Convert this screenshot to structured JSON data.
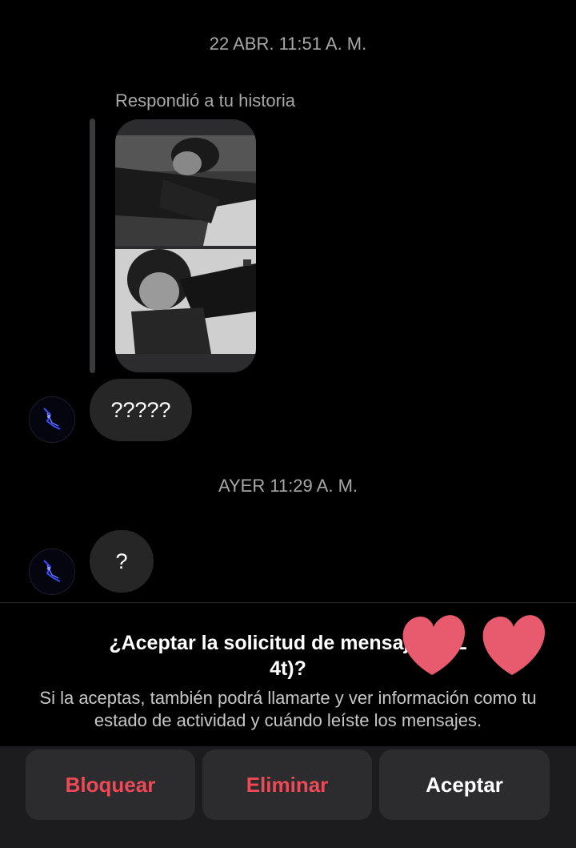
{
  "conversation": {
    "timestamp_1": "22 ABR. 11:51 A. M.",
    "reply_label": "Respondió a tu historia",
    "message_1": "?????",
    "timestamp_2": "AYER 11:29 A. M.",
    "message_2": "?"
  },
  "request": {
    "title_line_1": "¿Aceptar la solicitud de mensaje de L",
    "title_line_2": "4t)?",
    "description": "Si la aceptas, también podrá llamarte y ver información como tu estado de actividad y cuándo leíste los mensajes."
  },
  "actions": {
    "block_label": "Bloquear",
    "delete_label": "Eliminar",
    "accept_label": "Aceptar"
  },
  "colors": {
    "background": "#000000",
    "bubble": "#262626",
    "destructive": "#ed4956",
    "secondary_text": "#a8a8a8",
    "redaction_heart": "#e85a6e"
  },
  "icons": {
    "avatar": "avatar-image",
    "redaction": "heart-sticker-icon"
  }
}
